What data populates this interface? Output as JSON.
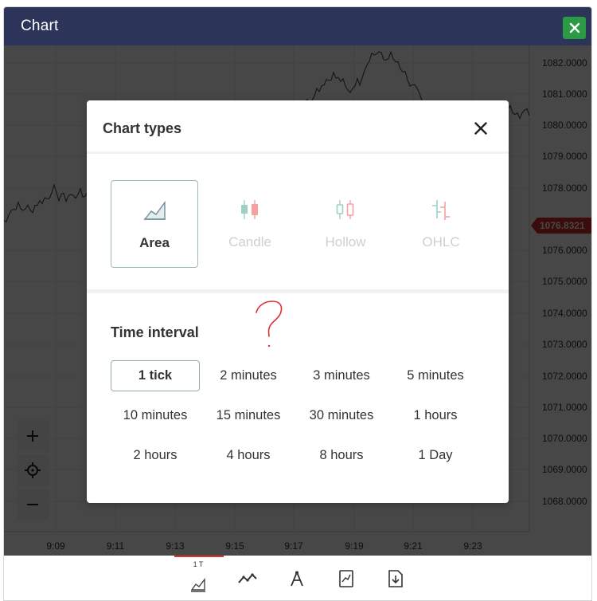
{
  "window": {
    "title": "Chart",
    "close_icon": "close-icon",
    "close_color": "#2b9a44",
    "titlebar_color": "#2c3559"
  },
  "chart": {
    "price_labels": [
      "1082.0000",
      "1081.0000",
      "1080.0000",
      "1079.0000",
      "1078.0000",
      "1076.8321",
      "1076.0000",
      "1075.0000",
      "1074.0000",
      "1073.0000",
      "1072.0000",
      "1071.0000",
      "1070.0000",
      "1069.0000",
      "1068.0000"
    ],
    "current_price": "1076.8321",
    "current_price_color": "#d62828",
    "time_labels": [
      "9:09",
      "9:11",
      "9:13",
      "9:15",
      "9:17",
      "9:19",
      "9:21",
      "9:23"
    ],
    "zoom_controls": {
      "zoom_in_icon": "plus-icon",
      "reset_icon": "crosshair-icon",
      "zoom_out_icon": "minus-icon"
    }
  },
  "toolbar": {
    "items": [
      {
        "icon": "area-chart-icon",
        "sub_label": "1 T",
        "active": true
      },
      {
        "icon": "indicators-icon",
        "sub_label": "",
        "active": false
      },
      {
        "icon": "drawing-tools-icon",
        "sub_label": "",
        "active": false
      },
      {
        "icon": "template-icon",
        "sub_label": "",
        "active": false
      },
      {
        "icon": "download-icon",
        "sub_label": "",
        "active": false
      }
    ]
  },
  "modal": {
    "title": "Chart types",
    "close_icon": "close-icon",
    "chart_types": [
      {
        "label": "Area",
        "icon": "area-icon",
        "selected": true
      },
      {
        "label": "Candle",
        "icon": "candle-icon",
        "selected": false
      },
      {
        "label": "Hollow",
        "icon": "hollow-candle-icon",
        "selected": false
      },
      {
        "label": "OHLC",
        "icon": "ohlc-icon",
        "selected": false
      }
    ],
    "time_interval_title": "Time interval",
    "intervals": [
      [
        "1 tick",
        "2 minutes",
        "3 minutes",
        "5 minutes"
      ],
      [
        "10 minutes",
        "15 minutes",
        "30 minutes",
        "1 hours"
      ],
      [
        "2 hours",
        "4 hours",
        "8 hours",
        "1 Day"
      ]
    ],
    "selected_interval": "1 tick"
  },
  "annotation": {
    "scribble_text": "?",
    "scribble_color": "#e03131"
  }
}
